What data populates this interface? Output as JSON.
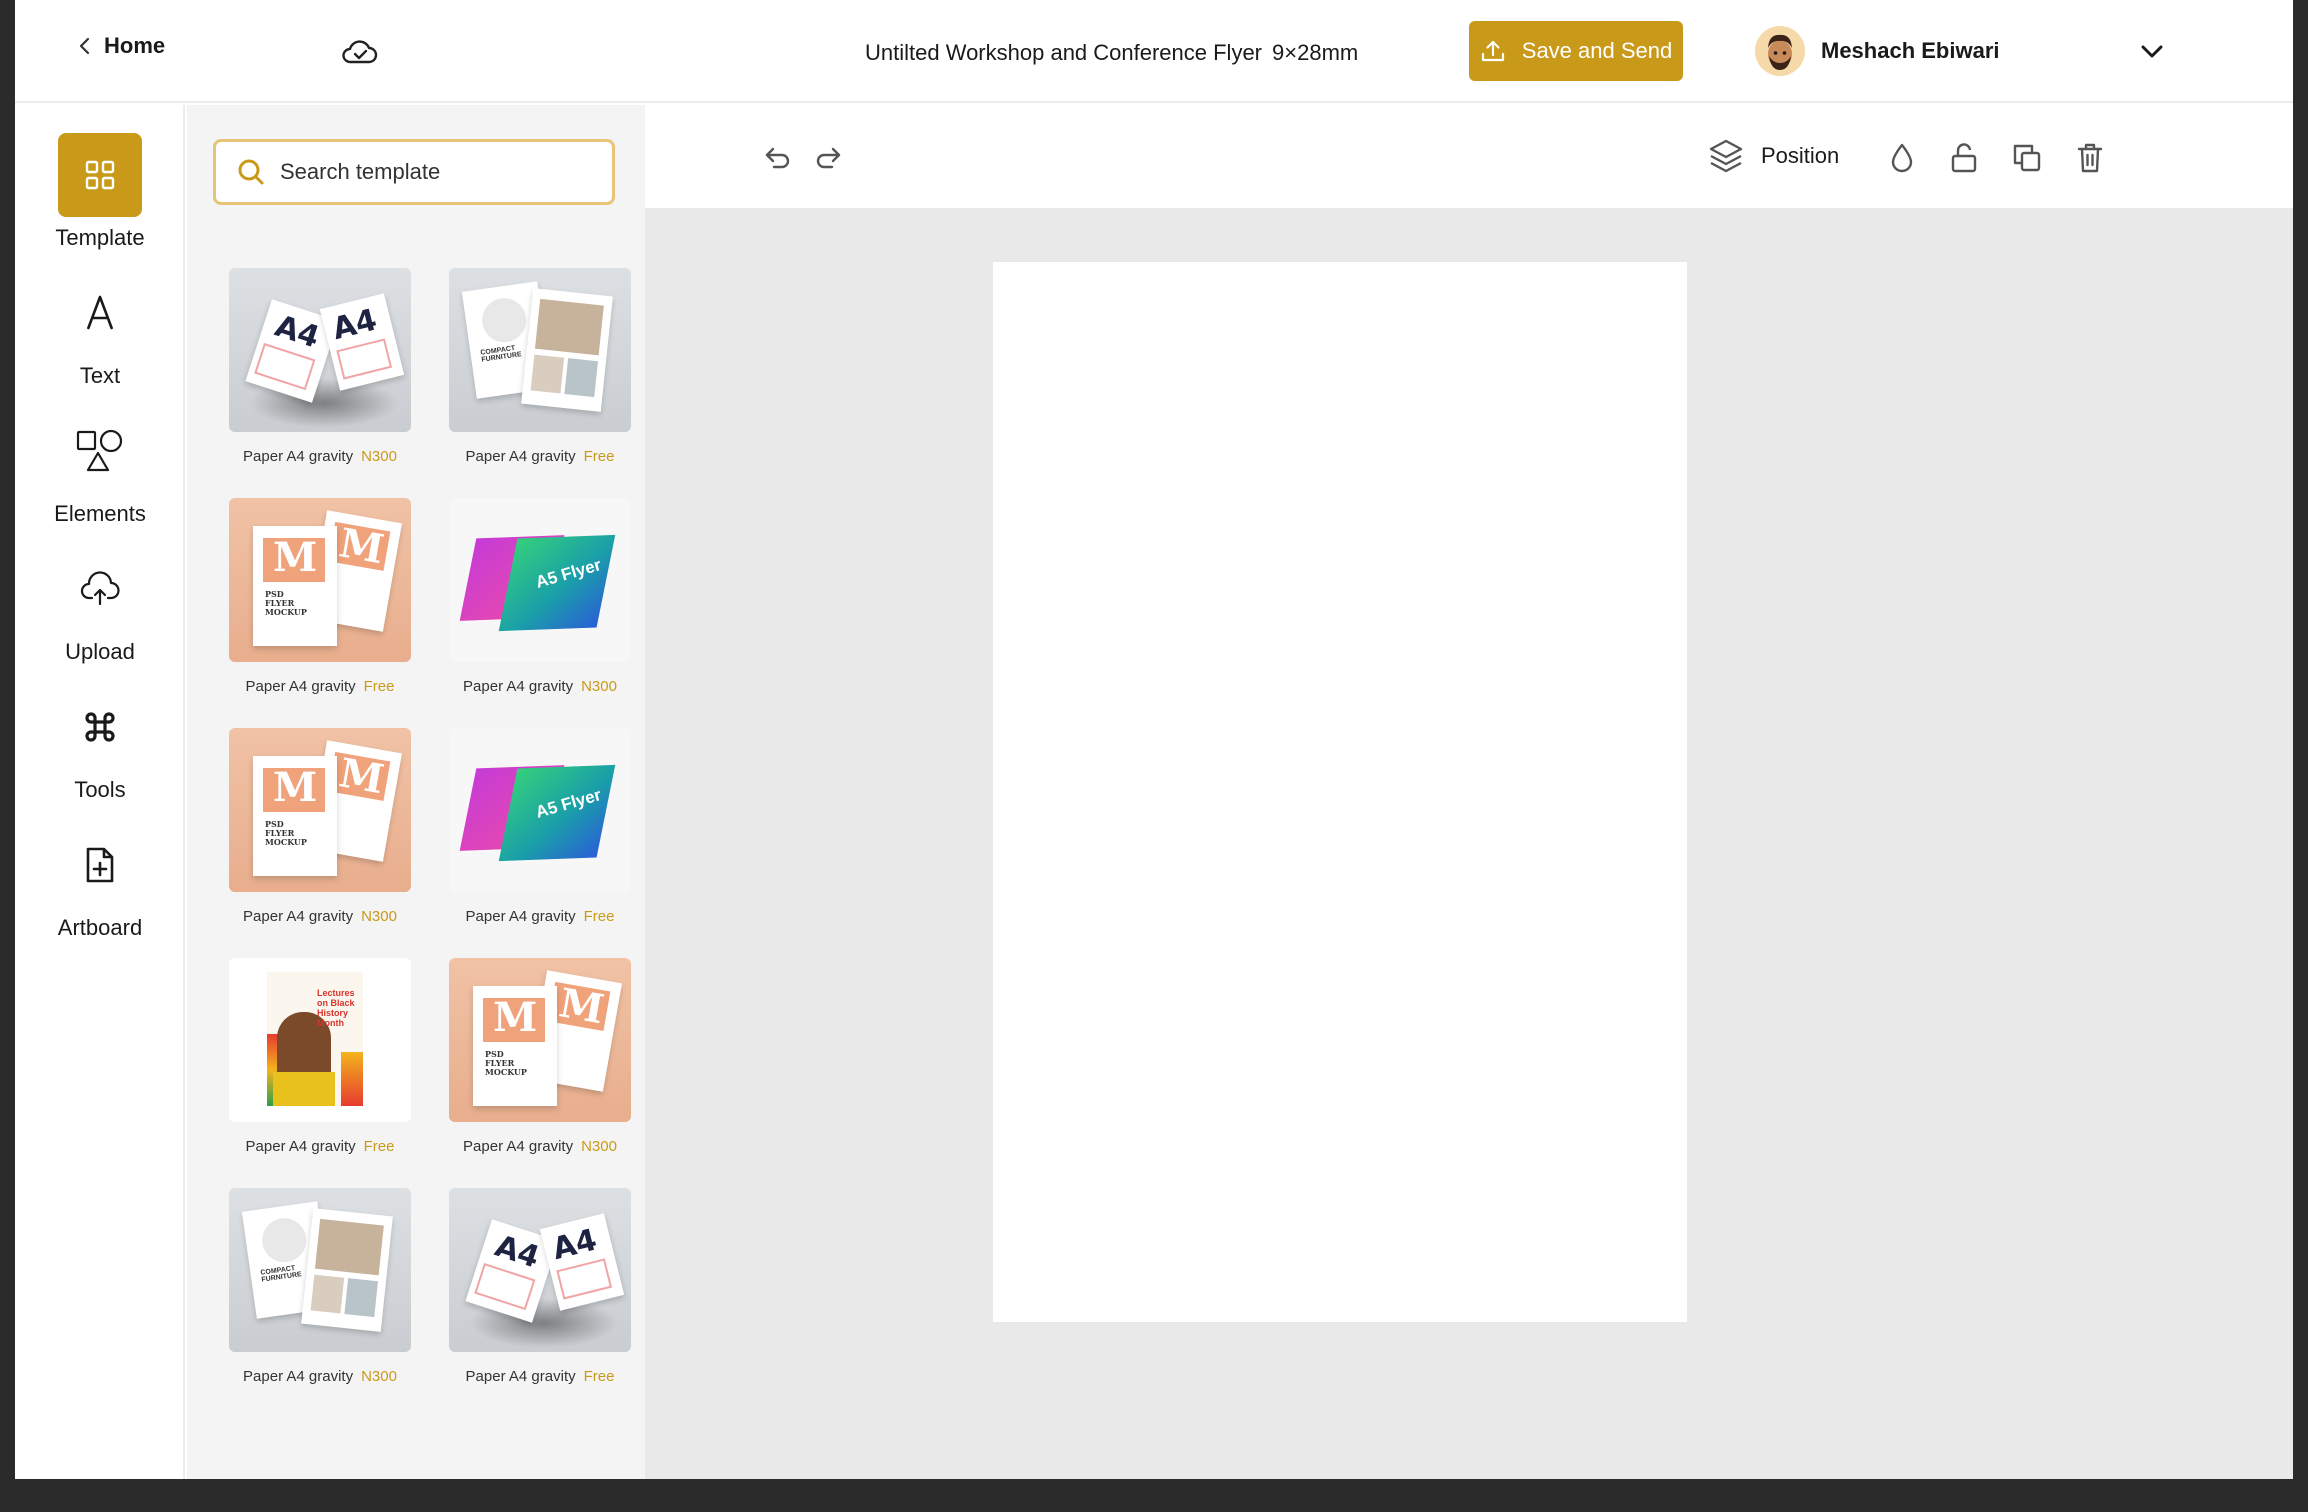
{
  "header": {
    "home_label": "Home",
    "doc_title": "Untilted Workshop and Conference Flyer",
    "doc_size": "9×28mm",
    "save_label": "Save and Send",
    "user_name": "Meshach Ebiwari"
  },
  "sidebar": {
    "items": [
      {
        "label": "Template",
        "icon": "grid-icon",
        "active": true
      },
      {
        "label": "Text",
        "icon": "text-icon"
      },
      {
        "label": "Elements",
        "icon": "shapes-icon"
      },
      {
        "label": "Upload",
        "icon": "cloud-upload-icon"
      },
      {
        "label": "Tools",
        "icon": "command-icon"
      },
      {
        "label": "Artboard",
        "icon": "file-plus-icon"
      }
    ]
  },
  "panel": {
    "search_placeholder": "Search template",
    "templates": [
      {
        "name": "Paper A4 gravity",
        "price": "N300"
      },
      {
        "name": "Paper A4 gravity",
        "price": "Free"
      },
      {
        "name": "Paper A4 gravity",
        "price": "Free"
      },
      {
        "name": "Paper A4 gravity",
        "price": "N300"
      },
      {
        "name": "Paper A4 gravity",
        "price": "N300"
      },
      {
        "name": "Paper A4 gravity",
        "price": "Free"
      },
      {
        "name": "Paper A4 gravity",
        "price": "Free"
      },
      {
        "name": "Paper A4 gravity",
        "price": "N300"
      },
      {
        "name": "Paper A4 gravity",
        "price": "N300"
      },
      {
        "name": "Paper A4 gravity",
        "price": "Free"
      }
    ],
    "thumb_text": {
      "a4": "A4",
      "psd": "PSD FLYER MOCKUP",
      "a5": "A5 Flyer",
      "lectures": "Lectures on Black History Month",
      "furniture": "COMPACT FURNITURE"
    }
  },
  "toolbar": {
    "position_label": "Position"
  },
  "colors": {
    "accent": "#c99a1a",
    "search_border": "#e6c578",
    "canvas_bg": "#e9e9e9"
  }
}
